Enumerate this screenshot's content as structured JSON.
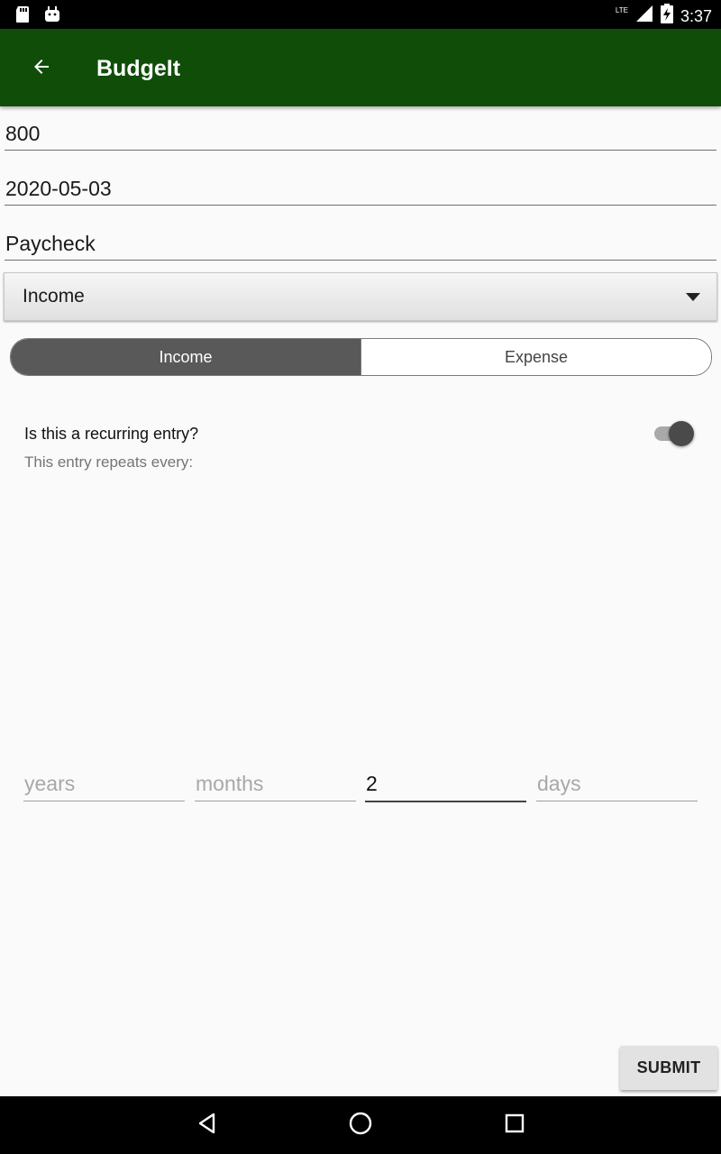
{
  "status_bar": {
    "time": "3:37",
    "network": "LTE",
    "icons": [
      "sd-card-icon",
      "android-debug-icon",
      "signal-icon",
      "battery-charging-icon"
    ]
  },
  "app_bar": {
    "title": "BudgeIt",
    "back_icon": "arrow-back-icon",
    "color": "#0f4d08"
  },
  "form": {
    "amount": "800",
    "date": "2020-05-03",
    "description": "Paycheck",
    "category": {
      "selected": "Income"
    },
    "type_toggle": {
      "options": [
        "Income",
        "Expense"
      ],
      "selected": "Income"
    },
    "recurring": {
      "label": "Is this a recurring entry?",
      "enabled": true,
      "repeat_label": "This entry repeats every:"
    },
    "interval": {
      "years": {
        "placeholder": "years",
        "value": ""
      },
      "months": {
        "placeholder": "months",
        "value": ""
      },
      "weeks": {
        "placeholder": "",
        "value": "2"
      },
      "days": {
        "placeholder": "days",
        "value": ""
      }
    },
    "submit_label": "SUBMIT"
  },
  "nav_bar": {
    "icons": [
      "back-triangle-icon",
      "home-circle-icon",
      "recents-square-icon"
    ]
  }
}
